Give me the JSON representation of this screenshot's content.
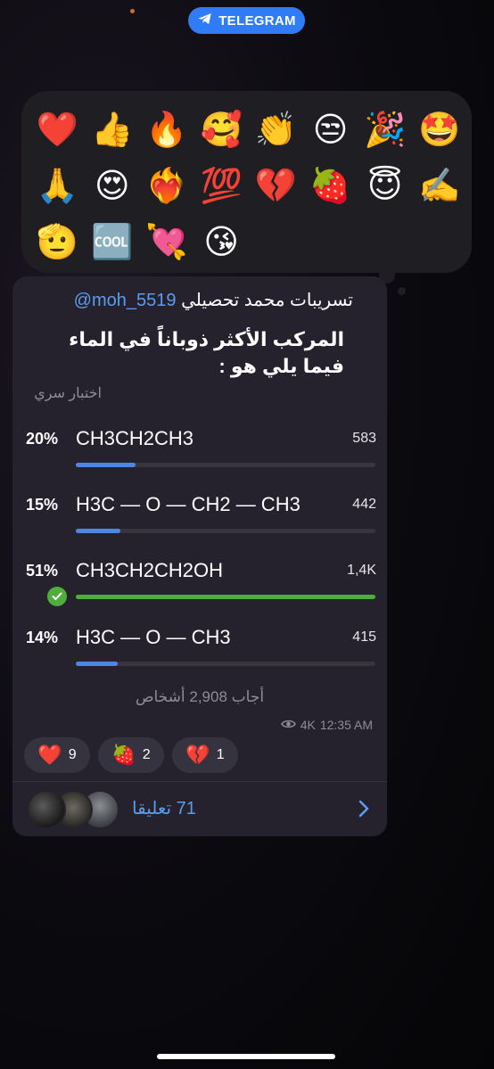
{
  "top_badge": {
    "label": "TELEGRAM",
    "icon": "telegram-plane-icon"
  },
  "reactions_menu": {
    "emojis": [
      "❤️",
      "👍",
      "🔥",
      "🥰",
      "👏",
      "😒",
      "🎉",
      "🤩",
      "🙏",
      "😍",
      "❤️‍🔥",
      "💯",
      "💔",
      "🍓",
      "😇",
      "✍️",
      "🫡",
      "🆒",
      "💘",
      "😘"
    ]
  },
  "message": {
    "sender_name": "تسريبات محمد تحصيلي",
    "sender_handle": "moh_5519@",
    "question": "المركب الأكثر ذوباناً في الماء فيما يلي هو :",
    "poll_type": "اختبار سري",
    "options": [
      {
        "percent": "20%",
        "text": "CH3CH2CH3",
        "count": "583",
        "fraction": 0.2,
        "correct": false
      },
      {
        "percent": "15%",
        "text": "H3C — O — CH2 — CH3",
        "count": "442",
        "fraction": 0.15,
        "correct": false
      },
      {
        "percent": "51%",
        "text": "CH3CH2CH2OH",
        "count": "1,4K",
        "fraction": 1.0,
        "correct": true
      },
      {
        "percent": "14%",
        "text": "H3C — O — CH3",
        "count": "415",
        "fraction": 0.14,
        "correct": false
      }
    ],
    "voters_text": "أجاب 2,908 أشخاص",
    "views": "4K",
    "time": "12:35 AM",
    "reactions": [
      {
        "emoji": "❤️",
        "count": "9"
      },
      {
        "emoji": "🍓",
        "count": "2"
      },
      {
        "emoji": "💔",
        "count": "1"
      }
    ],
    "comments_label": "71 تعليقا"
  },
  "colors": {
    "accent": "#2f7cf6",
    "link": "#5b9cf0",
    "bar": "#4f86e6",
    "correct": "#4fad3b",
    "bubble": "#25222d"
  }
}
